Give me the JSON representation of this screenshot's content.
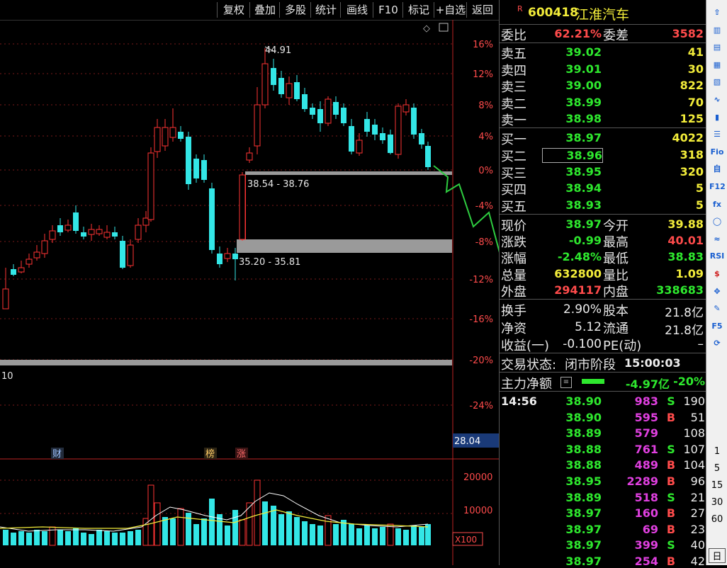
{
  "toolbar": {
    "buttons": [
      "复权",
      "叠加",
      "多股",
      "统计",
      "画线",
      "F10",
      "标记",
      "+自选",
      "返回"
    ]
  },
  "quote_header": {
    "r_badge": "R",
    "code": "600418",
    "name": "江淮汽车"
  },
  "order_book": {
    "webi_label": "委比",
    "webi_value": "62.21%",
    "weicha_label": "委差",
    "weicha_value": "3582",
    "sell": [
      {
        "label": "卖五",
        "price": "39.02",
        "vol": "41"
      },
      {
        "label": "卖四",
        "price": "39.01",
        "vol": "30"
      },
      {
        "label": "卖三",
        "price": "39.00",
        "vol": "822"
      },
      {
        "label": "卖二",
        "price": "38.99",
        "vol": "70"
      },
      {
        "label": "卖一",
        "price": "38.98",
        "vol": "125"
      }
    ],
    "buy": [
      {
        "label": "买一",
        "price": "38.97",
        "vol": "4022"
      },
      {
        "label": "买二",
        "price": "38.96",
        "vol": "318"
      },
      {
        "label": "买三",
        "price": "38.95",
        "vol": "320"
      },
      {
        "label": "买四",
        "price": "38.94",
        "vol": "5"
      },
      {
        "label": "买五",
        "price": "38.93",
        "vol": "5"
      }
    ]
  },
  "stats": {
    "rows": [
      {
        "l1": "现价",
        "v1": "38.97",
        "l2": "今开",
        "v2": "39.88"
      },
      {
        "l1": "涨跌",
        "v1": "-0.99",
        "l2": "最高",
        "v2": "40.01"
      },
      {
        "l1": "涨幅",
        "v1": "-2.48%",
        "l2": "最低",
        "v2": "38.83"
      },
      {
        "l1": "总量",
        "v1": "632800",
        "l2": "量比",
        "v2": "1.09"
      },
      {
        "l1": "外盘",
        "v1": "294117",
        "l2": "内盘",
        "v2": "338683"
      }
    ],
    "rows2": [
      {
        "l1": "换手",
        "v1": "2.90%",
        "l2": "股本",
        "v2": "21.8亿"
      },
      {
        "l1": "净资",
        "v1": "5.12",
        "l2": "流通",
        "v2": "21.8亿"
      },
      {
        "l1": "收益(一)",
        "v1": "-0.100",
        "l2": "PE(动)",
        "v2": "–"
      }
    ]
  },
  "status": {
    "label": "交易状态:",
    "value": "闭市阶段",
    "time": "15:00:03"
  },
  "main_force": {
    "label": "主力净额",
    "value": "-4.97亿",
    "pct": "-20%"
  },
  "ticks": {
    "time": "14:56",
    "rows": [
      {
        "price": "38.90",
        "vol": "983",
        "side": "S",
        "n": "190"
      },
      {
        "price": "38.90",
        "vol": "595",
        "side": "B",
        "n": "51"
      },
      {
        "price": "38.89",
        "vol": "579",
        "side": "",
        "n": "108"
      },
      {
        "price": "38.88",
        "vol": "761",
        "side": "S",
        "n": "107"
      },
      {
        "price": "38.88",
        "vol": "489",
        "side": "B",
        "n": "104"
      },
      {
        "price": "38.95",
        "vol": "2289",
        "side": "B",
        "n": "96"
      },
      {
        "price": "38.89",
        "vol": "518",
        "side": "S",
        "n": "21"
      },
      {
        "price": "38.97",
        "vol": "160",
        "side": "B",
        "n": "27"
      },
      {
        "price": "38.97",
        "vol": "69",
        "side": "B",
        "n": "23"
      },
      {
        "price": "38.97",
        "vol": "399",
        "side": "S",
        "n": "40"
      },
      {
        "price": "38.97",
        "vol": "254",
        "side": "B",
        "n": "42"
      }
    ]
  },
  "chart": {
    "y_ticks": [
      "16%",
      "12%",
      "8%",
      "4%",
      "0%",
      "-4%",
      "-8%",
      "-12%",
      "-16%",
      "-20%",
      "-24%"
    ],
    "vol_ticks": [
      "20000",
      "10000"
    ],
    "vol_unit": "X100",
    "price_tag": "28.04",
    "left_label": "10",
    "peak_label": "44.91",
    "zone1": "38.54 - 38.76",
    "zone2": "35.20 - 35.81",
    "markers": [
      "财",
      "榜",
      "涨"
    ]
  },
  "sidebar": {
    "icons": [
      "up-arrow-icon",
      "kline-icon",
      "minute-icon",
      "f10-icon",
      "bar-icon",
      "line-icon",
      "candle-icon",
      "list-icon",
      "fio-icon",
      "zi-icon",
      "f12-icon",
      "fx-icon",
      "o-icon",
      "wave-icon",
      "rsi-icon",
      "dollar-icon",
      "move-icon",
      "pen-icon",
      "f5-icon",
      "refresh-icon"
    ],
    "numbers": [
      "1",
      "5",
      "15",
      "30",
      "60"
    ],
    "bottom": "日"
  },
  "colors": {
    "up": "#ff3333",
    "down": "#33e6e6",
    "accent_green": "#2ee82e",
    "yellow": "#f2ec3a"
  }
}
